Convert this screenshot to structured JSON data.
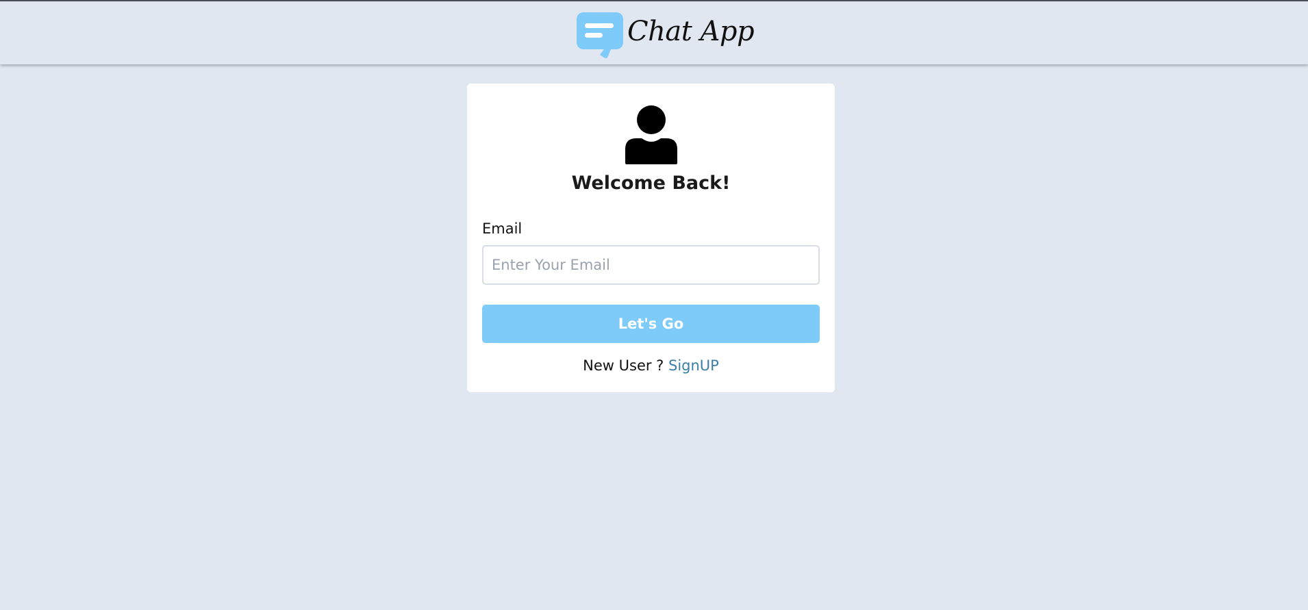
{
  "header": {
    "app_name": "Chat App",
    "logo_icon": "chat-bubble-icon",
    "logo_color": "#7ecbfa"
  },
  "login": {
    "avatar_icon": "user-icon",
    "title": "Welcome Back!",
    "email_label": "Email",
    "email_placeholder": "Enter Your Email",
    "email_value": "",
    "submit_label": "Let's Go",
    "submit_color": "#7ecbfa",
    "new_user_text": "New User ?",
    "signup_label": "SignUP",
    "signup_color": "#3a7fa5"
  },
  "colors": {
    "page_background": "#e0e7f0",
    "card_background": "#ffffff"
  }
}
